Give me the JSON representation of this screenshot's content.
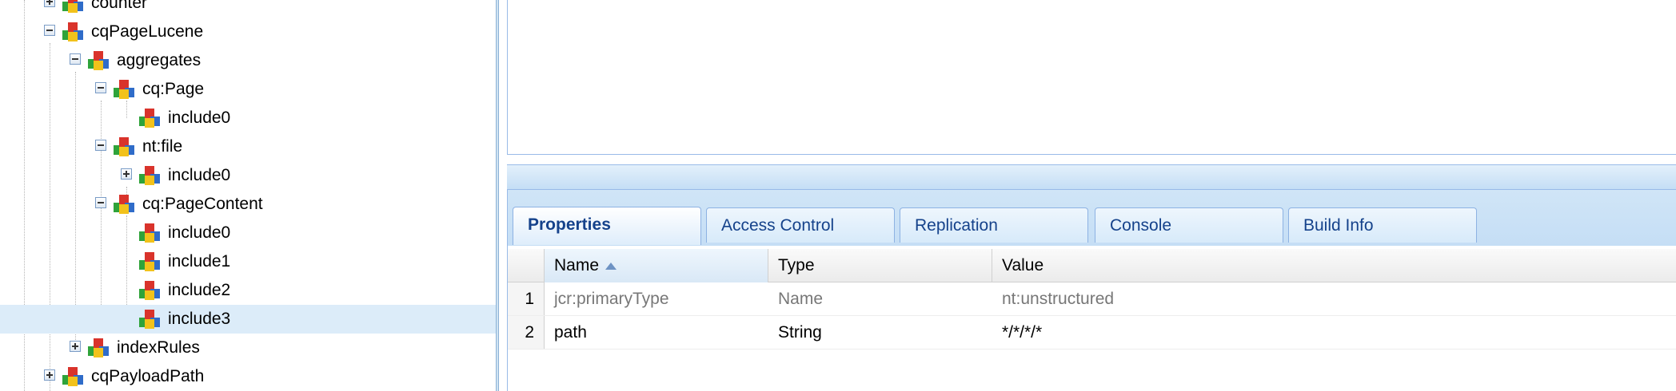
{
  "tree": {
    "nodes": [
      {
        "label": "counter",
        "toggle": "plus"
      },
      {
        "label": "cqPageLucene",
        "toggle": "minus"
      },
      {
        "label": "aggregates",
        "toggle": "minus"
      },
      {
        "label": "cq:Page",
        "toggle": "minus"
      },
      {
        "label": "include0",
        "toggle": "none"
      },
      {
        "label": "nt:file",
        "toggle": "minus"
      },
      {
        "label": "include0",
        "toggle": "plus"
      },
      {
        "label": "cq:PageContent",
        "toggle": "minus"
      },
      {
        "label": "include0",
        "toggle": "none"
      },
      {
        "label": "include1",
        "toggle": "none"
      },
      {
        "label": "include2",
        "toggle": "none"
      },
      {
        "label": "include3",
        "toggle": "none",
        "selected": true
      },
      {
        "label": "indexRules",
        "toggle": "plus"
      },
      {
        "label": "cqPayloadPath",
        "toggle": "plus"
      }
    ]
  },
  "tabs": [
    {
      "label": "Properties",
      "active": true
    },
    {
      "label": "Access Control"
    },
    {
      "label": "Replication"
    },
    {
      "label": "Console"
    },
    {
      "label": "Build Info"
    }
  ],
  "grid": {
    "columns": [
      "Name",
      "Type",
      "Value"
    ],
    "sorted_column": "Name",
    "rows": [
      {
        "num": "1",
        "name": "jcr:primaryType",
        "type": "Name",
        "value": "nt:unstructured",
        "muted": true
      },
      {
        "num": "2",
        "name": "path",
        "type": "String",
        "value": "*/*/*/*"
      }
    ]
  },
  "icons": {
    "node": "node-cube-icon",
    "colors": {
      "red": "#d9332b",
      "blue": "#2f6cc9",
      "yellow": "#f2c21b",
      "green": "#2fa33a"
    }
  }
}
